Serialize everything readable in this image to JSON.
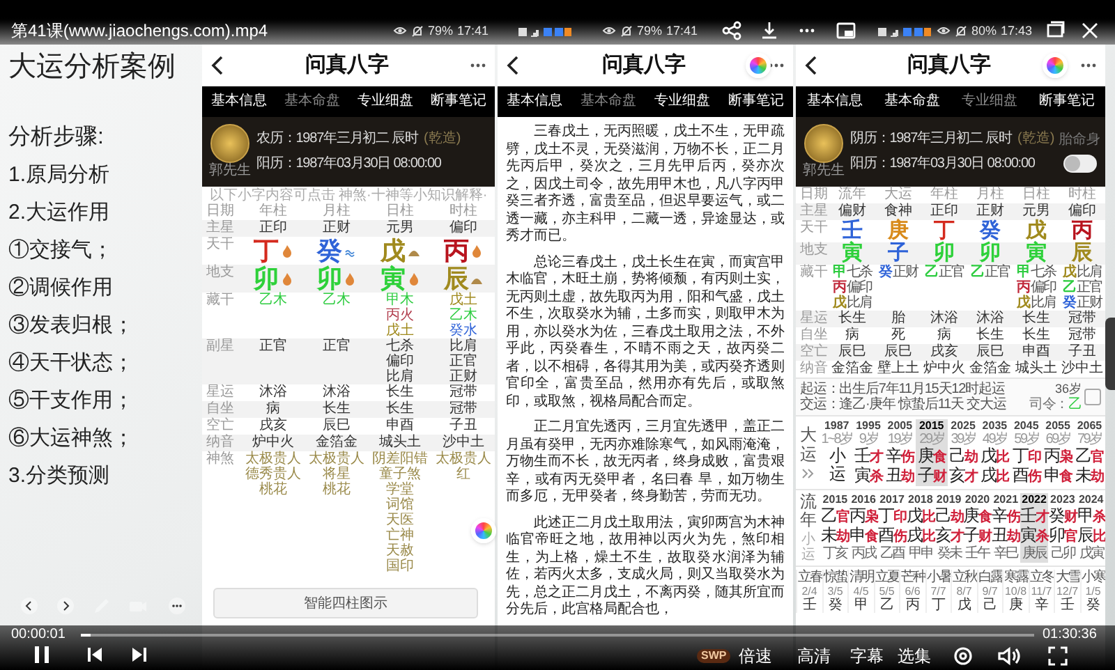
{
  "video": {
    "title": "第41课(www.jiaochengs.com).mp4",
    "elapsed": "00:00:01",
    "duration": "01:30:36",
    "level": 0.01,
    "playing": true,
    "badge": "SWP",
    "menu": [
      "倍速",
      "高清",
      "字幕",
      "选集"
    ]
  },
  "slide": {
    "title": "大运分析案例",
    "heading": "分析步骤:",
    "steps": [
      "1.原局分析",
      "2.大运作用",
      "①交接气；",
      "②调候作用",
      "③发表归根；",
      "④天干状态；",
      "⑤干支作用；",
      "⑥大运神煞；",
      "3.分类预测"
    ]
  },
  "phones": [
    {
      "kind": "chart",
      "status": {
        "battery": "79%",
        "time": "17:41"
      },
      "title": "问真八字",
      "tabs": [
        {
          "label": "基本信息",
          "selected": false
        },
        {
          "label": "基本命盘",
          "selected": true
        },
        {
          "label": "专业细盘",
          "selected": false
        },
        {
          "label": "断事笔记",
          "selected": false
        }
      ],
      "card": {
        "name": "郭先生",
        "lunar": "农历：1987年三月初二 辰时",
        "gender": "(乾造)",
        "solar": "阳历：1987年03月30日 08:00:00"
      },
      "note": "以下小字内容可点击 神煞·十神等小知识解释·",
      "rows": [
        {
          "label": "日期",
          "kind": "header",
          "cells": [
            "年柱",
            "月柱",
            "日柱",
            "时柱"
          ]
        },
        {
          "label": "主星",
          "kind": "text",
          "cells": [
            "正印",
            "正财",
            "元男",
            "偏印"
          ]
        },
        {
          "label": "天干",
          "kind": "glyph",
          "cells": [
            {
              "text": "丁",
              "color": "#d42a1e",
              "kind": "fire"
            },
            {
              "text": "癸",
              "color": "#2f63d8",
              "kind": "water"
            },
            {
              "text": "戊",
              "color": "#a08a1e",
              "kind": "earth"
            },
            {
              "text": "丙",
              "color": "#b8141e",
              "kind": "fire"
            }
          ]
        },
        {
          "label": "地支",
          "kind": "glyph",
          "cells": [
            {
              "text": "卯",
              "color": "#2ed13a",
              "kind": "fire"
            },
            {
              "text": "卯",
              "color": "#2ed13a",
              "kind": "fire"
            },
            {
              "text": "寅",
              "color": "#2ed13a",
              "kind": "fire"
            },
            {
              "text": "辰",
              "color": "#a08a1e",
              "kind": "earth"
            }
          ]
        },
        {
          "label": "藏干",
          "kind": "colored",
          "cells": [
            [
              {
                "text": "乙木",
                "color": "#2ecc40"
              }
            ],
            [
              {
                "text": "乙木",
                "color": "#2ecc40"
              }
            ],
            [
              {
                "text": "甲木",
                "color": "#2ecc40"
              },
              {
                "text": "丙火",
                "color": "#b03a4a"
              },
              {
                "text": "戊土",
                "color": "#a08a1e"
              }
            ],
            [
              {
                "text": "戊土",
                "color": "#a08a1e"
              },
              {
                "text": "乙木",
                "color": "#2ecc40"
              },
              {
                "text": "癸水",
                "color": "#2f63d8"
              }
            ]
          ]
        },
        {
          "label": "副星",
          "kind": "lines",
          "cells": [
            [
              "正官"
            ],
            [
              "正官"
            ],
            [
              "七杀",
              "偏印",
              "比肩"
            ],
            [
              "比肩",
              "正官",
              "正财"
            ]
          ]
        },
        {
          "label": "星运",
          "kind": "text",
          "cells": [
            "沐浴",
            "沐浴",
            "长生",
            "冠带"
          ]
        },
        {
          "label": "自坐",
          "kind": "text",
          "cells": [
            "病",
            "长生",
            "长生",
            "冠带"
          ]
        },
        {
          "label": "空亡",
          "kind": "text",
          "cells": [
            "戌亥",
            "辰巳",
            "申酉",
            "子丑"
          ]
        },
        {
          "label": "纳音",
          "kind": "text",
          "cells": [
            "炉中火",
            "金箔金",
            "城头土",
            "沙中土"
          ]
        },
        {
          "label": "神煞",
          "kind": "shensha",
          "cells": [
            [
              "太极贵人",
              "德秀贵人",
              "桃花"
            ],
            [
              "太极贵人",
              "将星",
              "桃花"
            ],
            [
              "阴差阳错",
              "童子煞",
              "学堂",
              "词馆",
              "天医",
              "亡神",
              "天赦",
              "国印"
            ],
            [
              "太极贵人",
              "红"
            ]
          ]
        }
      ],
      "button": "智能四柱图示"
    },
    {
      "kind": "text",
      "status": {
        "battery": "79%",
        "time": "17:41"
      },
      "title": "问真八字",
      "tabs": [
        {
          "label": "基本信息",
          "selected": false
        },
        {
          "label": "基本命盘",
          "selected": true
        },
        {
          "label": "专业细盘",
          "selected": false
        },
        {
          "label": "断事笔记",
          "selected": false
        }
      ],
      "paragraphs": [
        "三春戊土，无丙照暖，戊土不生，无甲疏劈，戊土不灵，无癸滋润，万物不长，正二月先丙后甲，癸次之，三月先甲后丙，癸亦次之，因戊土司令，故先用甲木也，凡八字丙甲癸三者齐透，富贵至品，但迟早要运气，或二透一藏，亦主科甲，二藏一透，异途显达，或秀才而已。",
        "总论三春戊土，戊土长生在寅，而寅宫甲木临官，木旺土崩，势将倾颓，有丙则土实，无丙则土虚，故先取丙为用，阳和气盛，戊土不生，次取癸水为辅，土多而实，则取甲木为用，亦以癸水为佐，三春戊土取用之法，不外乎此，丙癸春生，不晴不雨之天，故丙癸二者，以不相碍，各得其用为美，或丙癸齐透则官印全，富贵至品，然用亦有先后，或取煞印，或取煞，视格局配合而定。",
        "正二月宜先透丙，三月宜先透甲，盖正二月虽有癸甲，无丙亦难除寒气，如风雨淹淹，万物生而不长，故无丙者，终身成败，富贵艰辛，或有丙无癸甲者，名曰春 旱，如万物生而多厄，无甲癸者，终身勤苦，劳而无功。",
        "此述正二月戊土取用法，寅卯两宫为木神临官帝旺之地，故用神以丙火为先，煞印相生，为上格，燥土不生，故取癸水润泽为辅佐，若丙火太多，支成火局，则又当取癸水为先，总之正二月戊土，不离丙癸，随其所宜而分先后，此宫格局配合也，"
      ]
    },
    {
      "kind": "detail",
      "status": {
        "battery": "80%",
        "time": "17:43"
      },
      "title": "问真八字",
      "tabs": [
        {
          "label": "基本信息",
          "selected": false
        },
        {
          "label": "基本命盘",
          "selected": false
        },
        {
          "label": "专业细盘",
          "selected": true
        },
        {
          "label": "断事笔记",
          "selected": false
        }
      ],
      "card": {
        "name": "郭先生",
        "lunar": "阴历：1987年三月初二 辰时",
        "gender": "(乾造)",
        "solar": "阳历：1987年03月30日 08:00:00",
        "toggle": {
          "label": "胎命身",
          "on": false
        }
      },
      "rows": [
        {
          "label": "日期",
          "kind": "header",
          "cells": [
            "流年",
            "大运",
            "年柱",
            "月柱",
            "日柱",
            "时柱"
          ]
        },
        {
          "label": "主星",
          "kind": "text",
          "cells": [
            "偏财",
            "食神",
            "正印",
            "正财",
            "元男",
            "偏印"
          ]
        },
        {
          "label": "天干",
          "kind": "glyph",
          "cells": [
            {
              "text": "壬",
              "color": "#2f63d8"
            },
            {
              "text": "庚",
              "color": "#d88a1a"
            },
            {
              "text": "丁",
              "color": "#d42a1e"
            },
            {
              "text": "癸",
              "color": "#2f63d8"
            },
            {
              "text": "戊",
              "color": "#a08a1e"
            },
            {
              "text": "丙",
              "color": "#b8141e"
            }
          ]
        },
        {
          "label": "地支",
          "kind": "glyph",
          "cells": [
            {
              "text": "寅",
              "color": "#2ed13a"
            },
            {
              "text": "子",
              "color": "#2f63d8"
            },
            {
              "text": "卯",
              "color": "#2ed13a"
            },
            {
              "text": "卯",
              "color": "#2ed13a"
            },
            {
              "text": "寅",
              "color": "#2ed13a"
            },
            {
              "text": "辰",
              "color": "#a08a1e"
            }
          ]
        },
        {
          "label": "藏干",
          "kind": "gods",
          "cells": [
            [
              {
                "char": "甲",
                "color": "#2ecc40",
                "god": "七杀"
              },
              {
                "char": "丙",
                "color": "#c0283a",
                "god": "偏印"
              },
              {
                "char": "戊",
                "color": "#a08a1e",
                "god": "比肩"
              }
            ],
            [
              {
                "char": "癸",
                "color": "#2f63d8",
                "god": "正财"
              }
            ],
            [
              {
                "char": "乙",
                "color": "#2ecc40",
                "god": "正官"
              }
            ],
            [
              {
                "char": "乙",
                "color": "#2ecc40",
                "god": "正官"
              }
            ],
            [
              {
                "char": "甲",
                "color": "#2ecc40",
                "god": "七杀"
              },
              {
                "char": "丙",
                "color": "#c0283a",
                "god": "偏印"
              },
              {
                "char": "戊",
                "color": "#a08a1e",
                "god": "比肩"
              }
            ],
            [
              {
                "char": "戊",
                "color": "#a08a1e",
                "god": "比肩"
              },
              {
                "char": "乙",
                "color": "#2ecc40",
                "god": "正官"
              },
              {
                "char": "癸",
                "color": "#2f63d8",
                "god": "正财"
              }
            ]
          ]
        },
        {
          "label": "星运",
          "kind": "text",
          "cells": [
            "长生",
            "胎",
            "沐浴",
            "沐浴",
            "长生",
            "冠带"
          ]
        },
        {
          "label": "自坐",
          "kind": "text",
          "cells": [
            "病",
            "死",
            "病",
            "长生",
            "长生",
            "冠带"
          ]
        },
        {
          "label": "空亡",
          "kind": "text",
          "cells": [
            "辰巳",
            "辰巳",
            "戌亥",
            "辰巳",
            "申酉",
            "子丑"
          ]
        },
        {
          "label": "纳音",
          "kind": "text",
          "cells": [
            "金箔金",
            "壁上土",
            "炉中火",
            "金箔金",
            "城头土",
            "沙中土"
          ]
        }
      ],
      "info": {
        "start": "起运：出生后7年11月15天12时起运",
        "change": "交运：逢乙·庚年 惊蛰后11天 交大运",
        "age": "36岁",
        "commander": {
          "label": "司令：",
          "value": "乙"
        }
      },
      "dayun": {
        "label": "大运",
        "items": [
          {
            "year": "1987",
            "age": "1~8岁",
            "stem": "小",
            "branch": "运",
            "selected": false
          },
          {
            "year": "1995",
            "age": "9岁",
            "stem": "壬",
            "stem_god": "才",
            "branch": "寅",
            "branch_god": "杀",
            "selected": false
          },
          {
            "year": "2005",
            "age": "19岁",
            "stem": "辛",
            "stem_god": "伤",
            "branch": "丑",
            "branch_god": "劫",
            "selected": false
          },
          {
            "year": "2015",
            "age": "29岁",
            "stem": "庚",
            "stem_god": "食",
            "branch": "子",
            "branch_god": "财",
            "selected": true
          },
          {
            "year": "2025",
            "age": "39岁",
            "stem": "己",
            "stem_god": "劫",
            "branch": "亥",
            "branch_god": "才",
            "selected": false
          },
          {
            "year": "2035",
            "age": "49岁",
            "stem": "戊",
            "stem_god": "比",
            "branch": "戌",
            "branch_god": "比",
            "selected": false
          },
          {
            "year": "2045",
            "age": "59岁",
            "stem": "丁",
            "stem_god": "印",
            "branch": "酉",
            "branch_god": "伤",
            "selected": false
          },
          {
            "year": "2055",
            "age": "69岁",
            "stem": "丙",
            "stem_god": "枭",
            "branch": "申",
            "branch_god": "食",
            "selected": false
          },
          {
            "year": "2065",
            "age": "79岁",
            "stem": "乙",
            "stem_god": "官",
            "branch": "未",
            "branch_god": "劫",
            "selected": false
          }
        ]
      },
      "liunian": {
        "label": "流年",
        "sublabel": "小运",
        "items": [
          {
            "year": "2015",
            "stem": "乙",
            "stem_god": "官",
            "branch": "未",
            "branch_god": "劫",
            "sub": "丁亥",
            "selected": false
          },
          {
            "year": "2016",
            "stem": "丙",
            "stem_god": "枭",
            "branch": "申",
            "branch_god": "食",
            "sub": "丙戌",
            "selected": false
          },
          {
            "year": "2017",
            "stem": "丁",
            "stem_god": "印",
            "branch": "酉",
            "branch_god": "伤",
            "sub": "乙酉",
            "selected": false
          },
          {
            "year": "2018",
            "stem": "戊",
            "stem_god": "比",
            "branch": "戌",
            "branch_god": "比",
            "sub": "甲申",
            "selected": false
          },
          {
            "year": "2019",
            "stem": "己",
            "stem_god": "劫",
            "branch": "亥",
            "branch_god": "才",
            "sub": "癸未",
            "selected": false
          },
          {
            "year": "2020",
            "stem": "庚",
            "stem_god": "食",
            "branch": "子",
            "branch_god": "财",
            "sub": "壬午",
            "selected": false
          },
          {
            "year": "2021",
            "stem": "辛",
            "stem_god": "伤",
            "branch": "丑",
            "branch_god": "劫",
            "sub": "辛巳",
            "selected": false
          },
          {
            "year": "2022",
            "stem": "壬",
            "stem_god": "才",
            "branch": "寅",
            "branch_god": "杀",
            "sub": "庚辰",
            "selected": true
          },
          {
            "year": "2023",
            "stem": "癸",
            "stem_god": "财",
            "branch": "卯",
            "branch_god": "官",
            "sub": "己卯",
            "selected": false
          },
          {
            "year": "2024",
            "stem": "甲",
            "stem_god": "杀",
            "branch": "辰",
            "branch_god": "比",
            "sub": "戊寅",
            "selected": false
          }
        ]
      },
      "terms": [
        {
          "name": "立春",
          "date": "2/4",
          "stem": "壬"
        },
        {
          "name": "惊蛰",
          "date": "3/5",
          "stem": "癸"
        },
        {
          "name": "清明",
          "date": "4/5",
          "stem": "甲"
        },
        {
          "name": "立夏",
          "date": "5/5",
          "stem": "乙"
        },
        {
          "name": "芒种",
          "date": "6/6",
          "stem": "丙"
        },
        {
          "name": "小暑",
          "date": "7/7",
          "stem": "丁"
        },
        {
          "name": "立秋",
          "date": "8/7",
          "stem": "戊"
        },
        {
          "name": "白露",
          "date": "9/7",
          "stem": "己"
        },
        {
          "name": "寒露",
          "date": "10/8",
          "stem": "庚"
        },
        {
          "name": "立冬",
          "date": "11/7",
          "stem": "辛"
        },
        {
          "name": "大雪",
          "date": "12/7",
          "stem": "壬"
        },
        {
          "name": "小寒",
          "date": "1/5",
          "stem": "癸"
        }
      ]
    }
  ]
}
